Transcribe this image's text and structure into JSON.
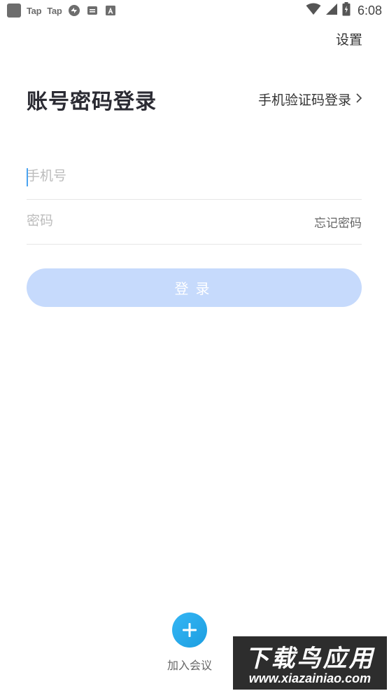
{
  "status_bar": {
    "left_items": [
      "Tap",
      "Tap"
    ],
    "time": "6:08",
    "icons": [
      "app-square-icon",
      "tap-icon",
      "tap-icon",
      "sync-icon",
      "message-icon",
      "a-box-icon",
      "wifi-icon",
      "signal-icon",
      "battery-icon"
    ]
  },
  "header": {
    "settings_label": "设置",
    "title": "账号密码登录",
    "sms_login_label": "手机验证码登录"
  },
  "form": {
    "phone_placeholder": "手机号",
    "phone_value": "",
    "password_placeholder": "密码",
    "password_value": "",
    "forgot_label": "忘记密码"
  },
  "login_button_label": "登录",
  "join_meeting_label": "加入会议",
  "watermark": {
    "title": "下载鸟应用",
    "url": "www.xiazainiao.com"
  },
  "colors": {
    "accent": "#1c9ee0",
    "login_button_disabled": "#c6dafc",
    "cursor": "#4aa3f0"
  }
}
